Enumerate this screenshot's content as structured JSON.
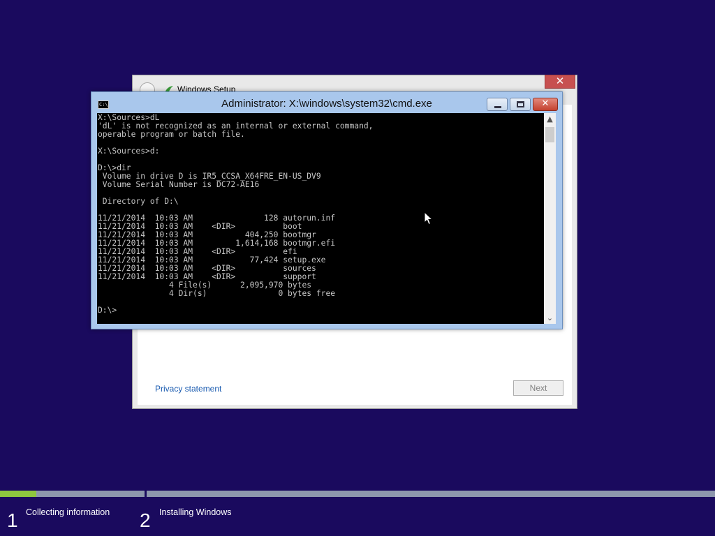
{
  "setup_window": {
    "title": "Windows Setup",
    "close_glyph": "✕",
    "privacy_link": "Privacy statement",
    "next_button": "Next"
  },
  "cmd_window": {
    "title": "Administrator: X:\\windows\\system32\\cmd.exe",
    "icon_text": "C:\\",
    "close_glyph": "✕",
    "console_text": "X:\\Sources>dL\n'dL' is not recognized as an internal or external command,\noperable program or batch file.\n\nX:\\Sources>d:\n\nD:\\>dir\n Volume in drive D is IR5_CCSA_X64FRE_EN-US_DV9\n Volume Serial Number is DC72-AE16\n\n Directory of D:\\\n\n11/21/2014  10:03 AM               128 autorun.inf\n11/21/2014  10:03 AM    <DIR>          boot\n11/21/2014  10:03 AM           404,250 bootmgr\n11/21/2014  10:03 AM         1,614,168 bootmgr.efi\n11/21/2014  10:03 AM    <DIR>          efi\n11/21/2014  10:03 AM            77,424 setup.exe\n11/21/2014  10:03 AM    <DIR>          sources\n11/21/2014  10:03 AM    <DIR>          support\n               4 File(s)      2,095,970 bytes\n               4 Dir(s)               0 bytes free\n\nD:\\>",
    "scroll_up_glyph": "▲",
    "scroll_down_glyph": "⌄"
  },
  "progress": {
    "step1_fraction": 0.25,
    "accent_color": "#8ec63f",
    "steps": [
      {
        "number": "1",
        "label": "Collecting information"
      },
      {
        "number": "2",
        "label": "Installing Windows"
      }
    ]
  },
  "colors": {
    "desktop_background": "#1a0a5e",
    "console_background": "#000000",
    "console_text": "#c7c7c7",
    "cmd_frame": "#a9c7ec"
  }
}
